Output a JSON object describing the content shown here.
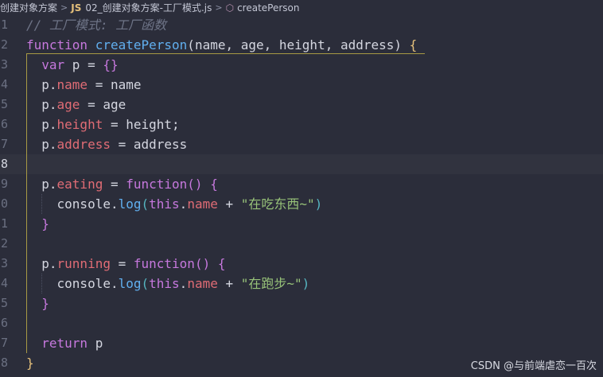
{
  "breadcrumb": {
    "folder": "创建对象方案",
    "file_badge": "JS",
    "file": "02_创建对象方案-工厂模式.js",
    "symbol": "createPerson",
    "folder_chevron": "chevron-right-icon",
    "symbol_icon": "method-cube-icon"
  },
  "editor": {
    "current_line": 8,
    "lines": [
      {
        "num": "1",
        "tokens": [
          {
            "t": "// 工厂模式: 工厂函数",
            "c": "comment"
          }
        ]
      },
      {
        "num": "2",
        "tokens": [
          {
            "t": "function ",
            "c": "keyword"
          },
          {
            "t": "createPerson",
            "c": "fn"
          },
          {
            "t": "(",
            "c": "plain"
          },
          {
            "t": "name, age, height, address",
            "c": "param"
          },
          {
            "t": ") ",
            "c": "plain"
          },
          {
            "t": "{",
            "c": "b1"
          }
        ]
      },
      {
        "num": "3",
        "tokens": [
          {
            "t": "  ",
            "c": "plain"
          },
          {
            "t": "var ",
            "c": "keyword"
          },
          {
            "t": "p = ",
            "c": "plain"
          },
          {
            "t": "{}",
            "c": "b2"
          }
        ]
      },
      {
        "num": "4",
        "tokens": [
          {
            "t": "  p.",
            "c": "plain"
          },
          {
            "t": "name",
            "c": "prop"
          },
          {
            "t": " = name",
            "c": "plain"
          }
        ]
      },
      {
        "num": "5",
        "tokens": [
          {
            "t": "  p.",
            "c": "plain"
          },
          {
            "t": "age",
            "c": "prop"
          },
          {
            "t": " = age",
            "c": "plain"
          }
        ]
      },
      {
        "num": "6",
        "tokens": [
          {
            "t": "  p.",
            "c": "plain"
          },
          {
            "t": "height",
            "c": "prop"
          },
          {
            "t": " = height;",
            "c": "plain"
          }
        ]
      },
      {
        "num": "7",
        "tokens": [
          {
            "t": "  p.",
            "c": "plain"
          },
          {
            "t": "address",
            "c": "prop"
          },
          {
            "t": " = address",
            "c": "plain"
          }
        ]
      },
      {
        "num": "8",
        "tokens": []
      },
      {
        "num": "9",
        "tokens": [
          {
            "t": "  p.",
            "c": "plain"
          },
          {
            "t": "eating",
            "c": "prop"
          },
          {
            "t": " = ",
            "c": "plain"
          },
          {
            "t": "function",
            "c": "keyword"
          },
          {
            "t": "() ",
            "c": "b2"
          },
          {
            "t": "{",
            "c": "b2"
          }
        ]
      },
      {
        "num": "0",
        "tokens": [
          {
            "t": "    console.",
            "c": "plain"
          },
          {
            "t": "log",
            "c": "fn"
          },
          {
            "t": "(",
            "c": "b3"
          },
          {
            "t": "this",
            "c": "keyword"
          },
          {
            "t": ".",
            "c": "plain"
          },
          {
            "t": "name",
            "c": "prop"
          },
          {
            "t": " + ",
            "c": "plain"
          },
          {
            "t": "\"在吃东西~\"",
            "c": "str"
          },
          {
            "t": ")",
            "c": "b3"
          }
        ]
      },
      {
        "num": "1",
        "tokens": [
          {
            "t": "  ",
            "c": "plain"
          },
          {
            "t": "}",
            "c": "b2"
          }
        ]
      },
      {
        "num": "2",
        "tokens": []
      },
      {
        "num": "3",
        "tokens": [
          {
            "t": "  p.",
            "c": "plain"
          },
          {
            "t": "running",
            "c": "prop"
          },
          {
            "t": " = ",
            "c": "plain"
          },
          {
            "t": "function",
            "c": "keyword"
          },
          {
            "t": "() ",
            "c": "b2"
          },
          {
            "t": "{",
            "c": "b2"
          }
        ]
      },
      {
        "num": "4",
        "tokens": [
          {
            "t": "    console.",
            "c": "plain"
          },
          {
            "t": "log",
            "c": "fn"
          },
          {
            "t": "(",
            "c": "b3"
          },
          {
            "t": "this",
            "c": "keyword"
          },
          {
            "t": ".",
            "c": "plain"
          },
          {
            "t": "name",
            "c": "prop"
          },
          {
            "t": " + ",
            "c": "plain"
          },
          {
            "t": "\"在跑步~\"",
            "c": "str"
          },
          {
            "t": ")",
            "c": "b3"
          }
        ]
      },
      {
        "num": "5",
        "tokens": [
          {
            "t": "  ",
            "c": "plain"
          },
          {
            "t": "}",
            "c": "b2"
          }
        ]
      },
      {
        "num": "6",
        "tokens": []
      },
      {
        "num": "7",
        "tokens": [
          {
            "t": "  ",
            "c": "plain"
          },
          {
            "t": "return ",
            "c": "keyword"
          },
          {
            "t": "p",
            "c": "plain"
          }
        ]
      },
      {
        "num": "8",
        "tokens": [
          {
            "t": "}",
            "c": "b1"
          }
        ]
      }
    ]
  },
  "watermark": "CSDN @与前端虐恋一百次"
}
